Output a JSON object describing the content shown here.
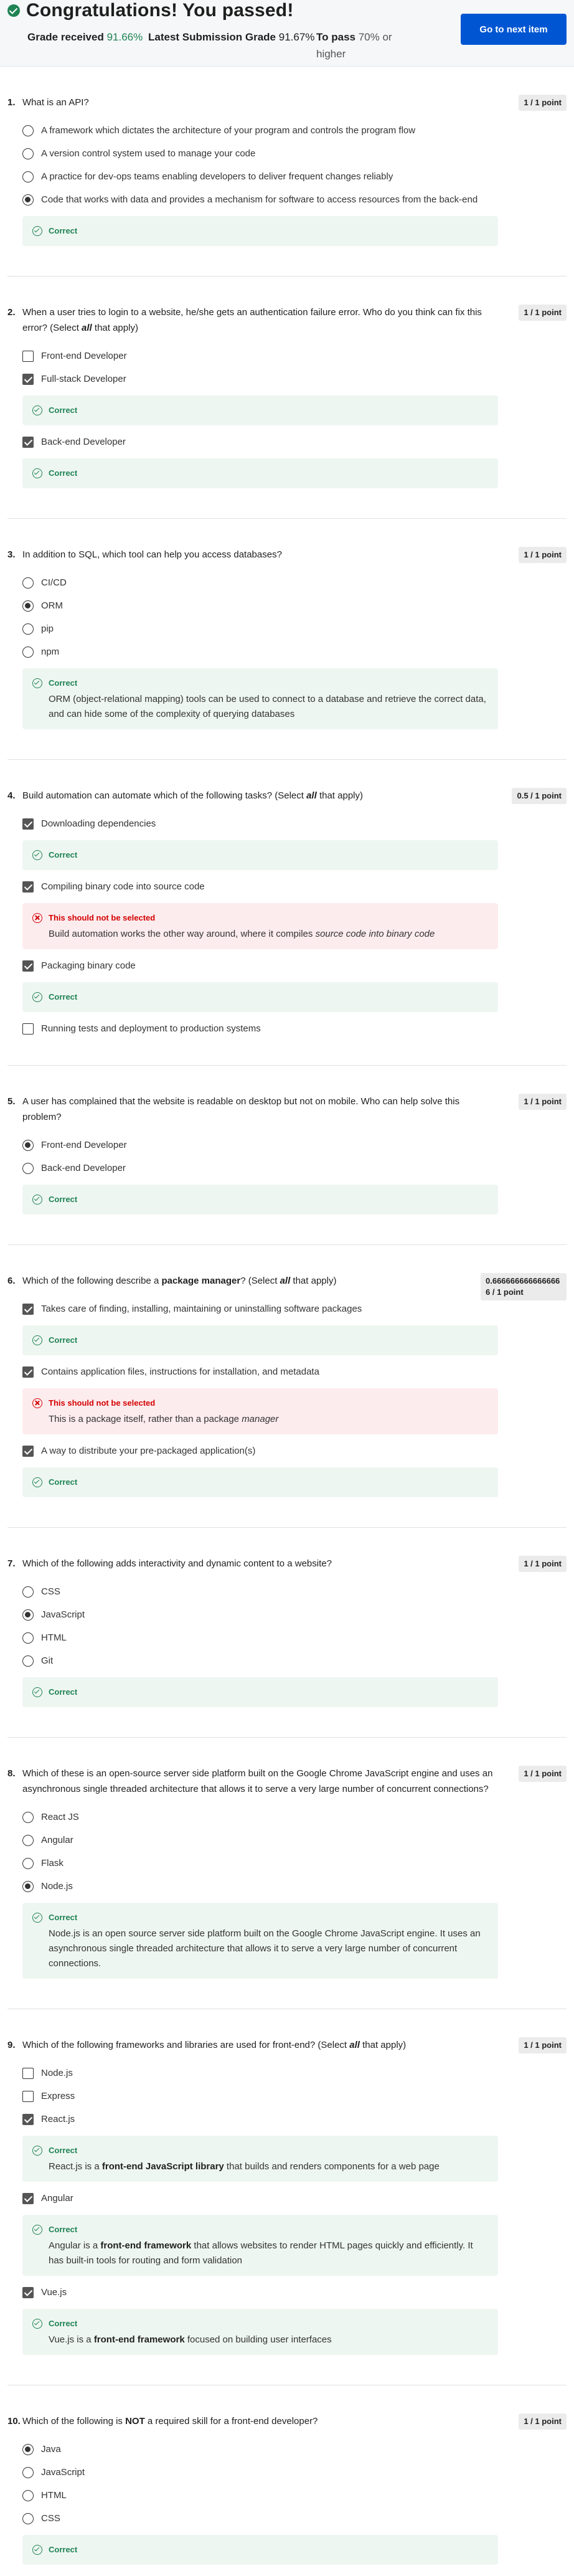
{
  "header": {
    "title": "Congratulations! You passed!",
    "grade_label": "Grade received",
    "grade_value": "91.66%",
    "latest_label": "Latest Submission Grade",
    "latest_value": "91.67%",
    "pass_label": "To pass",
    "pass_value": "70% or higher",
    "next_button": "Go to next item"
  },
  "feedback_labels": {
    "correct": "Correct",
    "incorrect": "This should not be selected"
  },
  "questions": [
    {
      "num": "1.",
      "text": "What is an API?",
      "points": "1 / 1 point",
      "options": [
        "A framework which dictates the architecture of your program and controls the program flow",
        "A version control system used to manage your code",
        "A practice for dev-ops teams enabling developers to deliver frequent changes reliably",
        "Code that works with data and provides a mechanism for software to access resources from the back-end"
      ]
    },
    {
      "num": "2.",
      "text_a": "When a user tries to login to a website, he/she gets an authentication failure error. Who do you think can fix this error? (Select ",
      "text_b": "all",
      "text_c": " that apply)",
      "points": "1 / 1 point",
      "options": [
        "Front-end Developer",
        "Full-stack Developer",
        "Back-end Developer"
      ]
    },
    {
      "num": "3.",
      "text": "In addition to SQL, which tool can help you access databases?",
      "points": "1 / 1 point",
      "options": [
        "CI/CD",
        "ORM",
        "pip",
        "npm"
      ],
      "feedback": "ORM (object-relational mapping) tools can be used to connect to a database and retrieve the correct data, and can hide some of the complexity of querying databases"
    },
    {
      "num": "4.",
      "text_a": "Build automation can automate which of the following tasks?  (Select ",
      "text_b": "all",
      "text_c": " that apply)",
      "points": "0.5 / 1 point",
      "options": [
        "Downloading dependencies",
        "Compiling binary code into source code",
        "Packaging binary code",
        "Running tests and deployment to production systems"
      ],
      "feedback_a": "Build automation works the other way around, where it compiles ",
      "feedback_b": "source code into binary code"
    },
    {
      "num": "5.",
      "text": "A user has complained that the website is readable on desktop but not on mobile. Who can help solve this problem?",
      "points": "1 / 1 point",
      "options": [
        "Front-end Developer",
        "Back-end Developer"
      ]
    },
    {
      "num": "6.",
      "text_a": "Which of the following describe a ",
      "text_b": "package manager",
      "text_c": "?  (Select ",
      "text_d": "all",
      "text_e": " that apply)",
      "points": "0.6666666666666666 / 1 point",
      "options": [
        "Takes care of finding, installing, maintaining or uninstalling software packages",
        "Contains application files, instructions for installation, and metadata",
        "A way to distribute your pre-packaged application(s)"
      ],
      "feedback_a": "This is a package itself, rather than a package ",
      "feedback_b": "manager"
    },
    {
      "num": "7.",
      "text": "Which of the following adds interactivity and dynamic content to a website?",
      "points": "1 / 1 point",
      "options": [
        "CSS",
        "JavaScript",
        "HTML",
        "Git"
      ]
    },
    {
      "num": "8.",
      "text": "Which of these is an open-source server side platform built on the Google Chrome JavaScript engine and uses an asynchronous single threaded architecture that allows it to serve a very large number of concurrent connections?",
      "points": "1 / 1 point",
      "options": [
        "React JS",
        "Angular",
        "Flask",
        "Node.js"
      ],
      "feedback": "Node.js is an open source server side platform built on the Google Chrome JavaScript engine. It uses an asynchronous single threaded architecture that allows it to serve a very large number of concurrent connections."
    },
    {
      "num": "9.",
      "text_a": "Which of the following frameworks and libraries are used for front-end? (Select ",
      "text_b": "all",
      "text_c": " that apply)",
      "points": "1 / 1 point",
      "options": [
        "Node.js",
        "Express",
        "React.js",
        "Angular",
        "Vue.js"
      ],
      "fb_react_a": "React.js is a ",
      "fb_react_b": "front-end JavaScript library",
      "fb_react_c": " that builds and renders components for a web page",
      "fb_angular_a": "Angular is a ",
      "fb_angular_b": "front-end framework",
      "fb_angular_c": " that allows websites to render HTML pages quickly and efficiently. It has built-in tools for routing and form validation",
      "fb_vue_a": "Vue.js is a ",
      "fb_vue_b": "front-end framework",
      "fb_vue_c": " focused on building user interfaces"
    },
    {
      "num": "10.",
      "text_a": "Which of the following is ",
      "text_b": "NOT",
      "text_c": " a required skill for a front-end developer?",
      "points": "1 / 1 point",
      "options": [
        "Java",
        "JavaScript",
        "HTML",
        "CSS"
      ]
    }
  ]
}
